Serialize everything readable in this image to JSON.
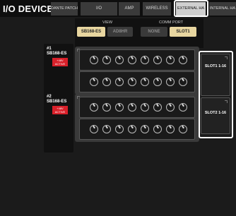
{
  "app_title": "I/O DEVICE",
  "tabs": [
    {
      "label": "DANTE PATCH",
      "active": false
    },
    {
      "label": "I/O",
      "active": false
    },
    {
      "label": "AMP",
      "active": false
    },
    {
      "label": "WIRELESS",
      "active": false
    },
    {
      "label": "EXTERNAL HA",
      "active": true
    },
    {
      "label": "INTERNAL HA",
      "active": false
    }
  ],
  "view": {
    "label": "VIEW",
    "options": [
      "SB168-ES",
      "AD8HR"
    ],
    "selected": "SB168-ES"
  },
  "comm_port": {
    "label": "COMM PORT",
    "options": [
      "NONE",
      "SLOT1"
    ],
    "selected": "SLOT1"
  },
  "devices": [
    {
      "id": "#1",
      "model": "SB168-ES",
      "warning": "+48V ACTIVE",
      "slot": "SLOT1 1-16"
    },
    {
      "id": "#2",
      "model": "SB168-ES",
      "warning": "+48V ACTIVE",
      "slot": "SLOT2 1-16"
    }
  ],
  "colors": {
    "selected_button": "#e8d6a0",
    "warning_badge": "#d8202a",
    "callout": "#ffffff"
  }
}
